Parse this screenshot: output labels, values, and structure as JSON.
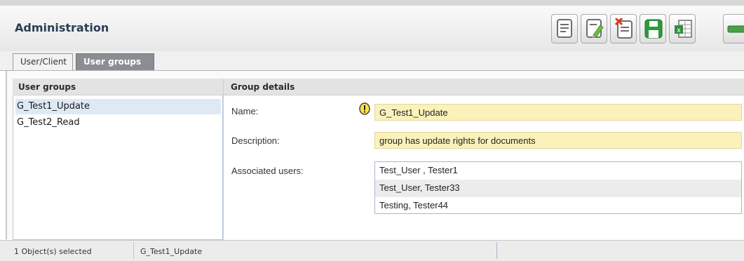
{
  "header": {
    "title": "Administration"
  },
  "toolbar": {
    "buttons": [
      {
        "name": "document-list-icon"
      },
      {
        "name": "edit-document-icon"
      },
      {
        "name": "delete-document-icon"
      },
      {
        "name": "save-icon"
      },
      {
        "name": "excel-export-icon"
      }
    ]
  },
  "tabs": [
    {
      "label": "User/Client",
      "active": false
    },
    {
      "label": "User groups",
      "active": true
    }
  ],
  "left_panel": {
    "header": "User groups",
    "items": [
      "G_Test1_Update",
      "G_Test2_Read"
    ]
  },
  "right_panel": {
    "header": "Group details",
    "name_label": "Name:",
    "name_value": "G_Test1_Update",
    "description_label": "Description:",
    "description_value": "group has update rights for documents",
    "assoc_label": "Associated users:",
    "assoc_users": [
      "Test_User , Tester1",
      "Test_User, Tester33",
      "Testing, Tester44"
    ]
  },
  "status": {
    "selected_count": "1 Object(s) selected",
    "selected_name": "G_Test1_Update"
  },
  "colors": {
    "field_bg": "#fbf1ba",
    "selection": "#dfe9f6",
    "title": "#2b3d52"
  }
}
